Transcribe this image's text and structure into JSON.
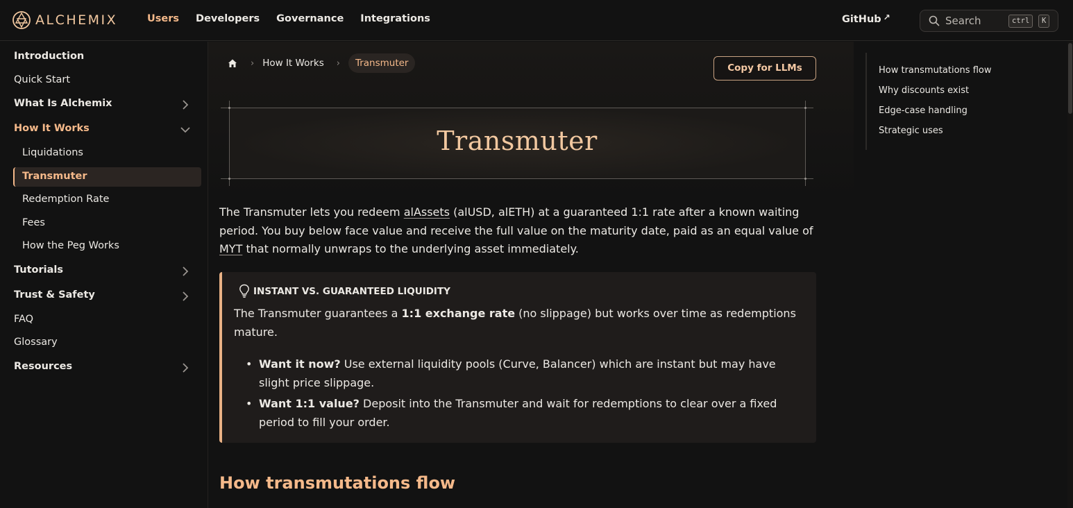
{
  "brand": {
    "name": "ALCHEMIX",
    "accent": "#f5b98a"
  },
  "nav": {
    "items": [
      {
        "label": "Users",
        "active": true
      },
      {
        "label": "Developers",
        "active": false
      },
      {
        "label": "Governance",
        "active": false
      },
      {
        "label": "Integrations",
        "active": false
      }
    ],
    "github_label": "GitHub",
    "search_placeholder": "Search",
    "shortcut_ctrl": "ctrl",
    "shortcut_key": "K"
  },
  "sidebar": {
    "introduction": "Introduction",
    "quick_start": "Quick Start",
    "what_is": "What Is Alchemix",
    "how_it_works": "How It Works",
    "liquidations": "Liquidations",
    "transmuter": "Transmuter",
    "redemption_rate": "Redemption Rate",
    "fees": "Fees",
    "peg": "How the Peg Works",
    "tutorials": "Tutorials",
    "trust_safety": "Trust & Safety",
    "faq": "FAQ",
    "glossary": "Glossary",
    "resources": "Resources"
  },
  "breadcrumb": {
    "home_icon": "home-icon",
    "parent": "How It Works",
    "current": "Transmuter"
  },
  "copy_button": "Copy for LLMs",
  "hero_title": "Transmuter",
  "intro": {
    "p1": "The Transmuter lets you redeem ",
    "link1": "alAssets",
    "p2": " (alUSD, alETH) at a guaranteed 1:1 rate after a known waiting period. You buy below face value and receive the full value on the maturity date, paid as an equal value of ",
    "link2": "MYT",
    "p3": " that normally unwraps to the underlying asset immediately."
  },
  "callout": {
    "title": "INSTANT VS. GUARANTEED LIQUIDITY",
    "body_pre": "The Transmuter guarantees a ",
    "body_bold": "1:1 exchange rate",
    "body_post": " (no slippage) but works over time as redemptions mature.",
    "bullets": [
      {
        "bold": "Want it now?",
        "text": " Use external liquidity pools (Curve, Balancer) which are instant but may have slight price slippage."
      },
      {
        "bold": "Want 1:1 value?",
        "text": " Deposit into the Transmuter and wait for redemptions to clear over a fixed period to fill your order."
      }
    ]
  },
  "section_heading": "How transmutations flow",
  "toc": [
    "How transmutations flow",
    "Why discounts exist",
    "Edge-case handling",
    "Strategic uses"
  ]
}
